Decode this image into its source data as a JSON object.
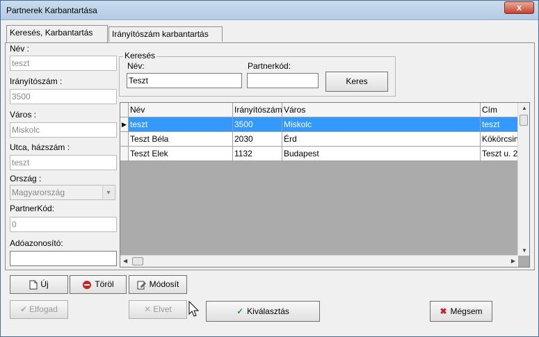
{
  "window": {
    "title": "Partnerek Karbantartása",
    "close_glyph": "x"
  },
  "tabs": [
    {
      "label": "Keresés, Karbantartás"
    },
    {
      "label": "Irányítószám karbantartás"
    }
  ],
  "form": {
    "name_label": "Név :",
    "name_value": "teszt",
    "zip_label": "Irányítószám :",
    "zip_value": "3500",
    "city_label": "Város :",
    "city_value": "Miskolc",
    "street_label": "Utca, házszám :",
    "street_value": "teszt",
    "country_label": "Ország :",
    "country_value": "Magyarország",
    "partnercode_label": "PartnerKód:",
    "partnercode_value": "0",
    "taxid_label": "Adóazonosító:",
    "taxid_value": ""
  },
  "search": {
    "group_title": "Keresés",
    "name_label": "Név:",
    "name_value": "Teszt",
    "code_label": "Partnerkód:",
    "code_value": "",
    "search_button": "Keres"
  },
  "grid": {
    "columns": [
      "Név",
      "Irányítószám",
      "Város",
      "Cím"
    ],
    "rows": [
      {
        "name": "teszt",
        "zip": "3500",
        "city": "Miskolc",
        "address": "teszt",
        "selected": true
      },
      {
        "name": "Teszt Béla",
        "zip": "2030",
        "city": "Érd",
        "address": "Kökörcsin",
        "selected": false
      },
      {
        "name": "Teszt Elek",
        "zip": "1132",
        "city": "Budapest",
        "address": "Teszt u. 2",
        "selected": false
      }
    ]
  },
  "buttons": {
    "new": "Új",
    "delete": "Töröl",
    "modify": "Módosít",
    "accept": "Elfogad",
    "discard": "Elvet",
    "select": "Kiválasztás",
    "cancel": "Mégsem"
  },
  "colors": {
    "selection": "#3399ff",
    "cancel_icon": "#c0262a",
    "check_icon": "#1f9b2f"
  }
}
